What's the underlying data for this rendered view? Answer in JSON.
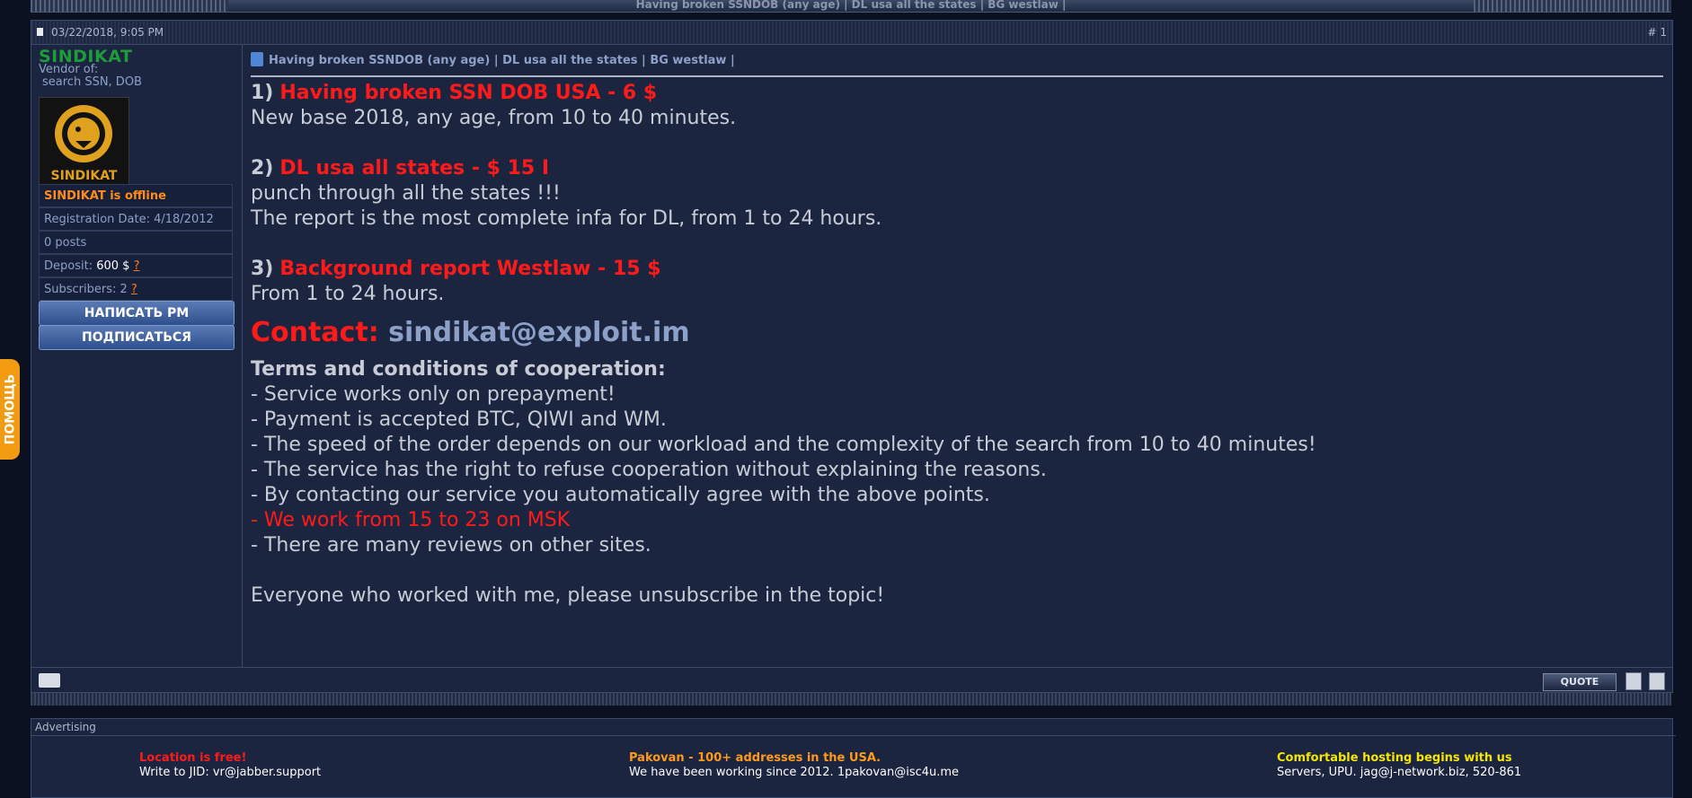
{
  "topbar": {
    "title": "Having broken SSNDOB (any age) | DL usa all the states | BG westlaw |"
  },
  "post": {
    "date": "03/22/2018, 9:05 PM",
    "number": "# 1",
    "title": "Having broken SSNDOB (any age) | DL usa all the states | BG westlaw |",
    "author": {
      "name": "SINDIKAT",
      "vendor_label": "Vendor of:",
      "vendor_value": "search SSN, DOB",
      "avatar_text": "SINDIKAT",
      "status": "SINDIKAT is offline",
      "registration": "Registration Date: 4/18/2012",
      "posts": "0 posts",
      "deposit_label": "Deposit:",
      "deposit_value": "600 $",
      "deposit_help": "?",
      "subscribers_label": "Subscribers: 2",
      "subscribers_help": "?",
      "pm_button": "НАПИСАТЬ РМ",
      "subscribe_button": "ПОДПИСАТЬСЯ"
    },
    "message": {
      "item1_num": "1)",
      "item1_title": "Having broken SSN DOB USA - 6 $",
      "item1_line1": "New base 2018, any age, from 10 to 40 minutes.",
      "item2_num": "2)",
      "item2_title": "DL usa all states - $ 15 I",
      "item2_line1": "punch through all the states !!!",
      "item2_line2": "The report is the most complete infa for DL, from 1 to 24 hours.",
      "item3_num": "3)",
      "item3_title": "Background report Westlaw - 15 $",
      "item3_line1": "From 1 to 24 hours.",
      "contact_label": "Contact:",
      "contact_email": "sindikat@exploit.im",
      "terms_title": "Terms and conditions of cooperation:",
      "terms": [
        "- Service works only on prepayment!",
        "- Payment is accepted BTC, QIWI and WM.",
        "- The speed of the order depends on our workload and the complexity of the search from 10 to 40 minutes!",
        "- The service has the right to refuse cooperation without explaining the reasons.",
        "- By contacting our service you automatically agree with the above points.",
        "- We work from 15 to 23 on MSK",
        "- There are many reviews on other sites."
      ],
      "closing": "Everyone who worked with me, please unsubscribe in the topic!"
    },
    "footer": {
      "quote_button": "QUOTE"
    }
  },
  "help_tab": "ПОМОЩЬ",
  "advertising": {
    "header": "Advertising",
    "ads": [
      {
        "title": "Location is free!",
        "subtitle": "Write to JID: vr@jabber.support"
      },
      {
        "title": "Pakovan - 100+ addresses in the USA.",
        "subtitle": "We have been working since 2012. 1pakovan@isc4u.me"
      },
      {
        "title": "Comfortable hosting begins with us",
        "subtitle": "Servers, UPU. jag@j-network.biz, 520-861"
      }
    ]
  }
}
